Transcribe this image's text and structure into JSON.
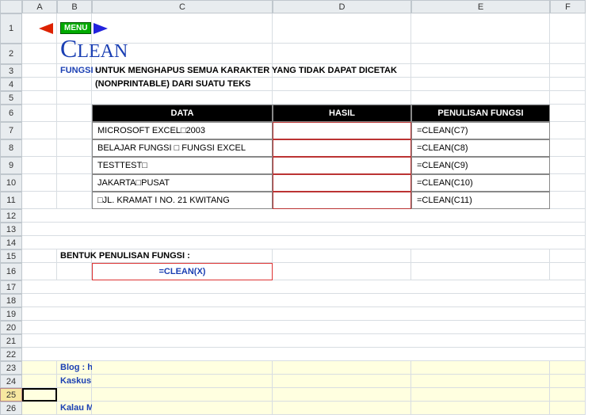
{
  "columns": [
    "A",
    "B",
    "C",
    "D",
    "E",
    "F"
  ],
  "nav": {
    "menu": "MENU"
  },
  "title": {
    "cap": "C",
    "rest": "LEAN"
  },
  "fungsi_label": "FUNGSI :",
  "fungsi_desc1": "UNTUK MENGHAPUS SEMUA KARAKTER YANG TIDAK DAPAT DICETAK",
  "fungsi_desc2": "(NONPRINTABLE) DARI SUATU TEKS",
  "headers": {
    "data": "DATA",
    "hasil": "HASIL",
    "penulisan": "PENULISAN FUNGSI"
  },
  "rows": [
    {
      "data": "MICROSOFT EXCEL□2003",
      "hasil": "",
      "formula": "=CLEAN(C7)"
    },
    {
      "data": "BELAJAR FUNGSI □ FUNGSI EXCEL",
      "hasil": "",
      "formula": "=CLEAN(C8)"
    },
    {
      "data": "TESTTEST□",
      "hasil": "",
      "formula": "=CLEAN(C9)"
    },
    {
      "data": "JAKARTA□PUSAT",
      "hasil": "",
      "formula": "=CLEAN(C10)"
    },
    {
      "data": "□JL. KRAMAT I NO. 21 KWITANG",
      "hasil": "",
      "formula": "=CLEAN(C11)"
    }
  ],
  "syntax_label": "BENTUK PENULISAN FUNGSI :",
  "syntax_formula": "=CLEAN(X)",
  "footer": {
    "blog": "Blog : http://romisatria.blogspot.com",
    "kaskus": "Kaskus : romisatria",
    "cendol": "Kalau Membantu Jangan Lupa Cendol Ya Gan"
  }
}
